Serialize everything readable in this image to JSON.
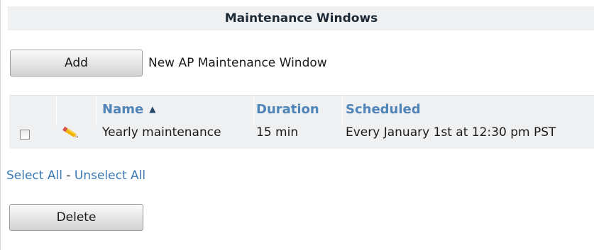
{
  "panel": {
    "title": "Maintenance Windows"
  },
  "toolbar": {
    "add_label": "Add",
    "add_description": "New AP Maintenance Window",
    "delete_label": "Delete"
  },
  "table": {
    "columns": [
      {
        "label": "Name",
        "sort": "ascending"
      },
      {
        "label": "Duration"
      },
      {
        "label": "Scheduled"
      }
    ],
    "rows": [
      {
        "checked": false,
        "icon": "pencil-edit-icon",
        "name": "Yearly maintenance",
        "duration": "15 min",
        "scheduled": "Every January 1st at 12:30 pm PST"
      }
    ]
  },
  "selection": {
    "select_all": "Select All",
    "separator": "-",
    "unselect_all": "Unselect All"
  },
  "colors": {
    "header_text": "#4f84b8",
    "link": "#3b7ab5",
    "panel_bg": "#eef0f2"
  }
}
